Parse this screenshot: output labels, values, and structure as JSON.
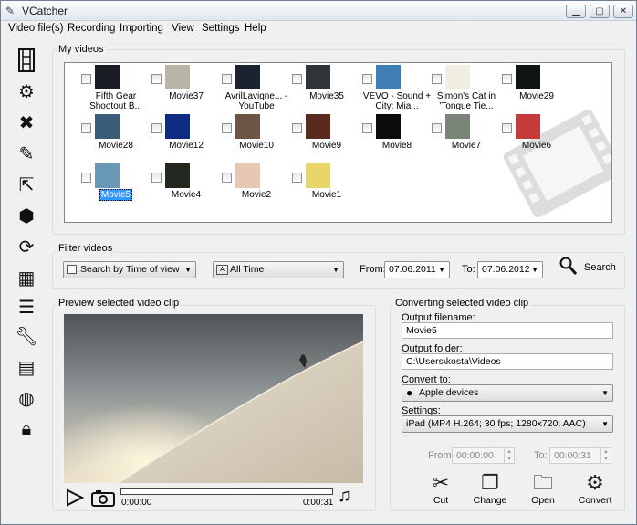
{
  "window": {
    "title": "VCatcher",
    "min": "▁",
    "max": "▢",
    "close": "✕"
  },
  "menu": [
    "Video file(s)",
    "Recording",
    "Importing",
    "View",
    "Settings",
    "Help"
  ],
  "toolbar_icons": [
    "film-icon",
    "gear-icon",
    "delete-icon",
    "pencil-icon",
    "import-icon",
    "package-icon",
    "convert-icon",
    "calendar-icon",
    "checklist-icon",
    "wrench-icon",
    "media-icon",
    "globe-icon",
    "lock-icon"
  ],
  "my_videos": {
    "label": "My videos",
    "items": [
      {
        "caption": "Fifth Gear Shootout B...",
        "color": "#1a1e24",
        "selected": false
      },
      {
        "caption": "Movie37",
        "color": "#b8b5a6",
        "selected": false
      },
      {
        "caption": "AvrilLavigne... - YouTube",
        "color": "#1b2230",
        "selected": false
      },
      {
        "caption": "Movie35",
        "color": "#2e3437",
        "selected": false
      },
      {
        "caption": "VEVO - Sound + City: Mia...",
        "color": "#3f7fb5",
        "selected": false
      },
      {
        "caption": "Simon's Cat in 'Tongue Tie...",
        "color": "#f1efe2",
        "selected": false
      },
      {
        "caption": "Movie29",
        "color": "#101512",
        "selected": false
      },
      {
        "caption": "Movie28",
        "color": "#3a5d7a",
        "selected": false
      },
      {
        "caption": "Movie12",
        "color": "#0e2a82",
        "selected": false
      },
      {
        "caption": "Movie10",
        "color": "#6d5545",
        "selected": false
      },
      {
        "caption": "Movie9",
        "color": "#5b2a1e",
        "selected": false
      },
      {
        "caption": "Movie8",
        "color": "#0b0b0b",
        "selected": false
      },
      {
        "caption": "Movie7",
        "color": "#7b8478",
        "selected": false
      },
      {
        "caption": "Movie6",
        "color": "#c63a3a",
        "selected": false
      },
      {
        "caption": "Movie5",
        "color": "#6a99b8",
        "selected": true
      },
      {
        "caption": "Movie4",
        "color": "#23291f",
        "selected": false
      },
      {
        "caption": "Movie2",
        "color": "#e7c9b3",
        "selected": false
      },
      {
        "caption": "Movie1",
        "color": "#e9d66a",
        "selected": false
      }
    ]
  },
  "filter": {
    "label": "Filter videos",
    "search_by": "Search by Time of view",
    "range": "All Time",
    "from_label": "From:",
    "from_value": "07.06.2011",
    "to_label": "To:",
    "to_value": "07.06.2012",
    "search_button": "Search"
  },
  "preview": {
    "label": "Preview selected video clip",
    "time_start": "0:00:00",
    "time_end": "0:00:31",
    "progress": 0.0
  },
  "convert": {
    "label": "Converting selected video clip",
    "output_filename_label": "Output filename:",
    "output_filename": "Movie5",
    "output_folder_label": "Output folder:",
    "output_folder": "C:\\Users\\kosta\\Videos",
    "convert_to_label": "Convert to:",
    "convert_to": "Apple devices",
    "settings_label": "Settings:",
    "settings": "iPad (MP4 H.264; 30 fps; 1280x720; AAC)",
    "from_label": "From:",
    "from_value": "00:00:00",
    "to_label": "To:",
    "to_value": "00:00:31",
    "buttons": {
      "cut": "Cut",
      "change": "Change",
      "open": "Open",
      "convert": "Convert"
    }
  }
}
